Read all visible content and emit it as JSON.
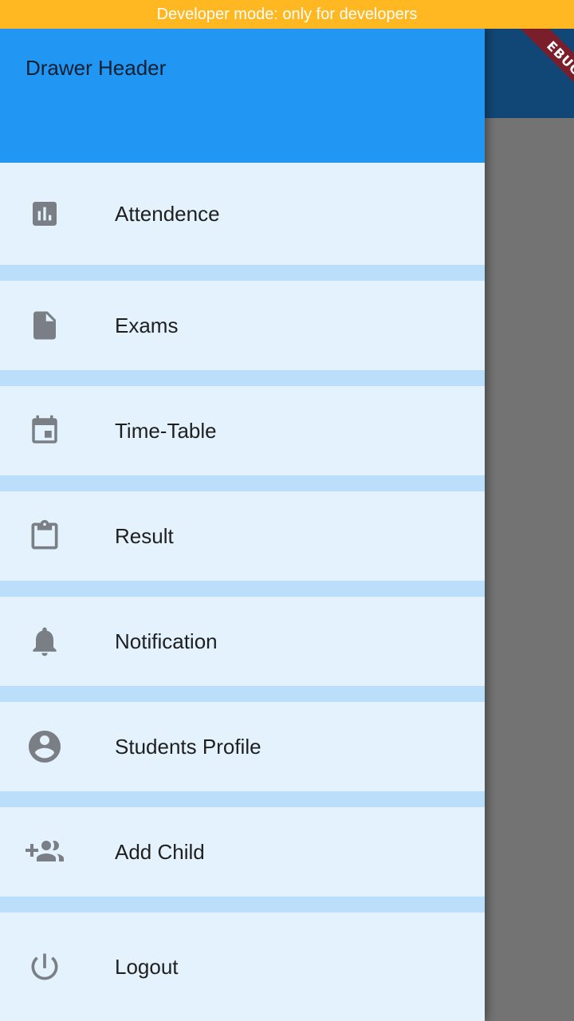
{
  "banner": {
    "text": "Developer mode: only for developers",
    "color": "#FFB722"
  },
  "debug_ribbon": {
    "text": "EBUG"
  },
  "drawer": {
    "header_title": "Drawer Header",
    "header_color": "#2196F3",
    "items": [
      {
        "label": "Attendence",
        "icon": "bar-chart-icon"
      },
      {
        "label": "Exams",
        "icon": "file-icon"
      },
      {
        "label": "Time-Table",
        "icon": "calendar-icon"
      },
      {
        "label": "Result",
        "icon": "clipboard-icon"
      },
      {
        "label": "Notification",
        "icon": "bell-icon"
      },
      {
        "label": "Students Profile",
        "icon": "account-circle-icon"
      },
      {
        "label": "Add Child",
        "icon": "group-add-icon"
      },
      {
        "label": "Logout",
        "icon": "power-icon"
      }
    ]
  }
}
